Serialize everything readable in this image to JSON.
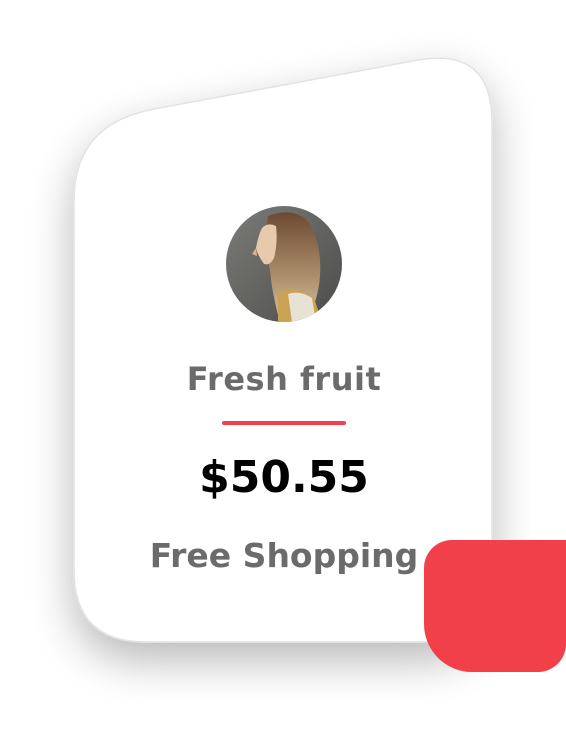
{
  "card": {
    "title": "Fresh fruit",
    "price": "$50.55",
    "subtitle": "Free Shopping"
  },
  "avatar": {
    "icon": "portrait-photo"
  },
  "colors": {
    "accent": "#f2404a",
    "card_background": "#ffffff",
    "title_text": "#6b6b6b",
    "price_text": "#000000"
  }
}
